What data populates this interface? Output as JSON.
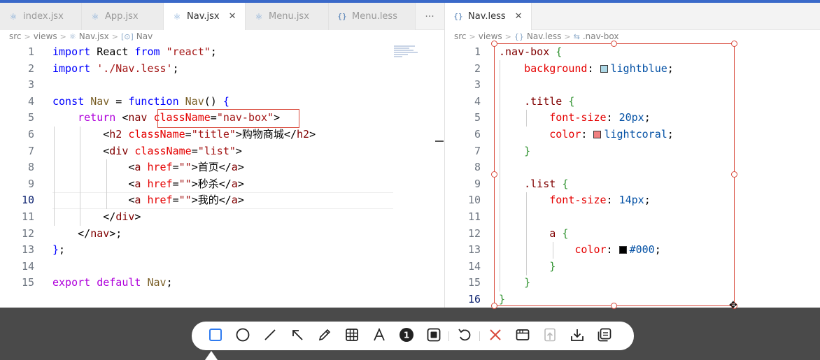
{
  "left_tabs": [
    {
      "label": "index.jsx",
      "icon": "react-icon"
    },
    {
      "label": "App.jsx",
      "icon": "react-icon"
    },
    {
      "label": "Nav.jsx",
      "icon": "react-icon",
      "active": true
    },
    {
      "label": "Menu.jsx",
      "icon": "react-icon"
    },
    {
      "label": "Menu.less",
      "icon": "braces-icon"
    }
  ],
  "left_more": "···",
  "right_tab": {
    "label": "Nav.less",
    "icon_text": "{}",
    "close": "✕"
  },
  "left_crumbs": {
    "a": "src",
    "b": "views",
    "c": "Nav.jsx",
    "d": "Nav",
    "d_icon": "[⊙]"
  },
  "right_crumbs": {
    "a": "src",
    "b": "views",
    "c": "Nav.less",
    "d": ".nav-box"
  },
  "left_lines": [
    {
      "n": "1",
      "tokens": [
        [
          "kw",
          "import"
        ],
        [
          "plain",
          " React "
        ],
        [
          "kw",
          "from"
        ],
        [
          "plain",
          " "
        ],
        [
          "str",
          "\"react\""
        ],
        [
          "plain",
          ";"
        ]
      ]
    },
    {
      "n": "2",
      "tokens": [
        [
          "kw",
          "import"
        ],
        [
          "plain",
          " "
        ],
        [
          "str",
          "'./Nav.less'"
        ],
        [
          "plain",
          ";"
        ]
      ]
    },
    {
      "n": "3",
      "tokens": []
    },
    {
      "n": "4",
      "tokens": [
        [
          "kw",
          "const"
        ],
        [
          "plain",
          " "
        ],
        [
          "id",
          "Nav"
        ],
        [
          "plain",
          " = "
        ],
        [
          "kw",
          "function"
        ],
        [
          "plain",
          " "
        ],
        [
          "id",
          "Nav"
        ],
        [
          "plain",
          "() "
        ],
        [
          "kw",
          "{"
        ]
      ]
    },
    {
      "n": "5",
      "tokens": [
        [
          "plain",
          "    "
        ],
        [
          "ctl",
          "return"
        ],
        [
          "plain",
          " <"
        ],
        [
          "tag",
          "nav"
        ],
        [
          "plain",
          " "
        ],
        [
          "attr",
          "className"
        ],
        [
          "plain",
          "="
        ],
        [
          "str",
          "\"nav-box\""
        ],
        [
          "plain",
          ">"
        ]
      ]
    },
    {
      "n": "6",
      "tokens": [
        [
          "plain",
          "        <"
        ],
        [
          "tag",
          "h2"
        ],
        [
          "plain",
          " "
        ],
        [
          "attr",
          "className"
        ],
        [
          "plain",
          "="
        ],
        [
          "str",
          "\"title\""
        ],
        [
          "plain",
          ">购物商城</"
        ],
        [
          "tag",
          "h2"
        ],
        [
          "plain",
          ">"
        ]
      ]
    },
    {
      "n": "7",
      "tokens": [
        [
          "plain",
          "        <"
        ],
        [
          "tag",
          "div"
        ],
        [
          "plain",
          " "
        ],
        [
          "attr",
          "className"
        ],
        [
          "plain",
          "="
        ],
        [
          "str",
          "\"list\""
        ],
        [
          "plain",
          ">"
        ]
      ]
    },
    {
      "n": "8",
      "tokens": [
        [
          "plain",
          "            <"
        ],
        [
          "tag",
          "a"
        ],
        [
          "plain",
          " "
        ],
        [
          "attr",
          "href"
        ],
        [
          "plain",
          "="
        ],
        [
          "str",
          "\"\""
        ],
        [
          "plain",
          ">首页</"
        ],
        [
          "tag",
          "a"
        ],
        [
          "plain",
          ">"
        ]
      ]
    },
    {
      "n": "9",
      "tokens": [
        [
          "plain",
          "            <"
        ],
        [
          "tag",
          "a"
        ],
        [
          "plain",
          " "
        ],
        [
          "attr",
          "href"
        ],
        [
          "plain",
          "="
        ],
        [
          "str",
          "\"\""
        ],
        [
          "plain",
          ">秒杀</"
        ],
        [
          "tag",
          "a"
        ],
        [
          "plain",
          ">"
        ]
      ]
    },
    {
      "n": "10",
      "tokens": [
        [
          "plain",
          "            <"
        ],
        [
          "tag",
          "a"
        ],
        [
          "plain",
          " "
        ],
        [
          "attr",
          "href"
        ],
        [
          "plain",
          "="
        ],
        [
          "str",
          "\"\""
        ],
        [
          "plain",
          ">我的</"
        ],
        [
          "tag",
          "a"
        ],
        [
          "plain",
          ">"
        ]
      ],
      "current": true
    },
    {
      "n": "11",
      "tokens": [
        [
          "plain",
          "        </"
        ],
        [
          "tag",
          "div"
        ],
        [
          "plain",
          ">"
        ]
      ]
    },
    {
      "n": "12",
      "tokens": [
        [
          "plain",
          "    </"
        ],
        [
          "tag",
          "nav"
        ],
        [
          "plain",
          ">;"
        ]
      ]
    },
    {
      "n": "13",
      "tokens": [
        [
          "kw",
          "}"
        ],
        [
          "plain",
          ";"
        ]
      ]
    },
    {
      "n": "14",
      "tokens": []
    },
    {
      "n": "15",
      "tokens": [
        [
          "ctl",
          "export"
        ],
        [
          "plain",
          " "
        ],
        [
          "ctl",
          "default"
        ],
        [
          "plain",
          " "
        ],
        [
          "id",
          "Nav"
        ],
        [
          "plain",
          ";"
        ]
      ]
    }
  ],
  "right_lines": [
    {
      "n": "1",
      "tokens": [
        [
          "sel",
          ".nav-box"
        ],
        [
          "plain",
          " "
        ],
        [
          "cbr",
          "{"
        ]
      ]
    },
    {
      "n": "2",
      "tokens": [
        [
          "plain",
          "    "
        ],
        [
          "prop",
          "background"
        ],
        [
          "plain",
          ": "
        ],
        [
          "swatch",
          "#add8e6"
        ],
        [
          "val",
          "lightblue"
        ],
        [
          "plain",
          ";"
        ]
      ]
    },
    {
      "n": "3",
      "tokens": []
    },
    {
      "n": "4",
      "tokens": [
        [
          "plain",
          "    "
        ],
        [
          "sel",
          ".title"
        ],
        [
          "plain",
          " "
        ],
        [
          "cbr",
          "{"
        ]
      ]
    },
    {
      "n": "5",
      "tokens": [
        [
          "plain",
          "        "
        ],
        [
          "prop",
          "font-size"
        ],
        [
          "plain",
          ": "
        ],
        [
          "val",
          "20px"
        ],
        [
          "plain",
          ";"
        ]
      ]
    },
    {
      "n": "6",
      "tokens": [
        [
          "plain",
          "        "
        ],
        [
          "prop",
          "color"
        ],
        [
          "plain",
          ": "
        ],
        [
          "swatch",
          "#f08080"
        ],
        [
          "val",
          "lightcoral"
        ],
        [
          "plain",
          ";"
        ]
      ]
    },
    {
      "n": "7",
      "tokens": [
        [
          "plain",
          "    "
        ],
        [
          "cbr",
          "}"
        ]
      ]
    },
    {
      "n": "8",
      "tokens": []
    },
    {
      "n": "9",
      "tokens": [
        [
          "plain",
          "    "
        ],
        [
          "sel",
          ".list"
        ],
        [
          "plain",
          " "
        ],
        [
          "cbr",
          "{"
        ]
      ]
    },
    {
      "n": "10",
      "tokens": [
        [
          "plain",
          "        "
        ],
        [
          "prop",
          "font-size"
        ],
        [
          "plain",
          ": "
        ],
        [
          "val",
          "14px"
        ],
        [
          "plain",
          ";"
        ]
      ]
    },
    {
      "n": "11",
      "tokens": []
    },
    {
      "n": "12",
      "tokens": [
        [
          "plain",
          "        "
        ],
        [
          "sel",
          "a"
        ],
        [
          "plain",
          " "
        ],
        [
          "cbr",
          "{"
        ]
      ]
    },
    {
      "n": "13",
      "tokens": [
        [
          "plain",
          "            "
        ],
        [
          "prop",
          "color"
        ],
        [
          "plain",
          ": "
        ],
        [
          "swatch",
          "#000000"
        ],
        [
          "val",
          "#000"
        ],
        [
          "plain",
          ";"
        ]
      ]
    },
    {
      "n": "14",
      "tokens": [
        [
          "plain",
          "        "
        ],
        [
          "cbr",
          "}"
        ]
      ]
    },
    {
      "n": "15",
      "tokens": [
        [
          "plain",
          "    "
        ],
        [
          "cbr",
          "}"
        ]
      ]
    },
    {
      "n": "16",
      "tokens": [
        [
          "cbr",
          "}"
        ]
      ],
      "current": true
    }
  ],
  "toolbar": [
    {
      "name": "rectangle-tool",
      "icon": "square-icon",
      "active": true
    },
    {
      "name": "ellipse-tool",
      "icon": "circle-icon"
    },
    {
      "name": "line-tool",
      "icon": "line-icon"
    },
    {
      "name": "arrow-tool",
      "icon": "arrow-icon"
    },
    {
      "name": "pen-tool",
      "icon": "pencil-icon"
    },
    {
      "name": "mosaic-tool",
      "icon": "grid-icon"
    },
    {
      "name": "text-tool",
      "icon": "text-icon"
    },
    {
      "name": "number-tool",
      "icon": "number-badge-icon",
      "label": "1"
    },
    {
      "name": "frame-tool",
      "icon": "frame-icon"
    },
    {
      "sep": true
    },
    {
      "name": "undo-button",
      "icon": "undo-icon"
    },
    {
      "sep": true
    },
    {
      "name": "cancel-button",
      "icon": "close-icon"
    },
    {
      "name": "window-button",
      "icon": "window-icon"
    },
    {
      "name": "pin-button",
      "icon": "pin-icon",
      "disabled": true
    },
    {
      "name": "download-button",
      "icon": "download-icon"
    },
    {
      "name": "copy-button",
      "icon": "copy-icon"
    }
  ],
  "colors": {
    "accent": "#2f7bf0",
    "annotation": "#d94a3c"
  }
}
